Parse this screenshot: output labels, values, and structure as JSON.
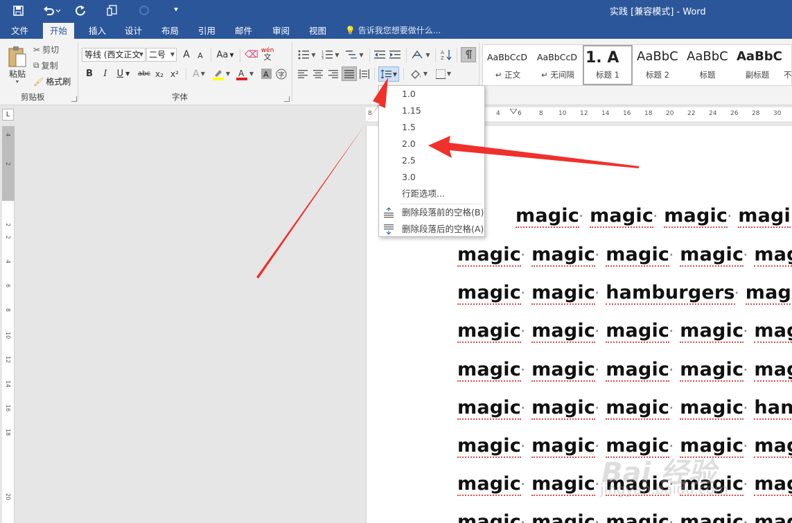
{
  "window": {
    "title": "实践 [兼容模式] - Word"
  },
  "quick_access": {
    "icons": [
      "save-icon",
      "undo-icon",
      "redo-icon",
      "touch-mode-icon",
      "customize-icon"
    ]
  },
  "tabs": [
    {
      "label": "文件"
    },
    {
      "label": "开始"
    },
    {
      "label": "插入"
    },
    {
      "label": "设计"
    },
    {
      "label": "布局"
    },
    {
      "label": "引用"
    },
    {
      "label": "邮件"
    },
    {
      "label": "审阅"
    },
    {
      "label": "视图"
    }
  ],
  "tell_me": "告诉我您想要做什么...",
  "clipboard": {
    "paste": "粘贴",
    "cut": "剪切",
    "copy": "复制",
    "format_painter": "格式刷",
    "group": "剪贴板"
  },
  "font": {
    "name": "等线 (西文正文",
    "size": "二号",
    "grow_label": "A",
    "shrink_label": "A",
    "case_label": "Aa",
    "phonetic_label": "wén",
    "bold": "B",
    "italic": "I",
    "underline": "U",
    "strike": "abc",
    "subscript": "x₂",
    "superscript": "x²",
    "group": "字体",
    "highlight_color": "#ffff00",
    "font_color": "#e02020"
  },
  "styles": [
    {
      "sample": "AaBbCcD",
      "name": "↵ 正文"
    },
    {
      "sample": "AaBbCcD",
      "name": "↵ 无间隔"
    },
    {
      "sample": "1.  A",
      "name": "标题 1"
    },
    {
      "sample": "AaBbC",
      "name": "标题 2"
    },
    {
      "sample": "AaBbC",
      "name": "标题"
    },
    {
      "sample": "AaBbC",
      "name": "副标题"
    },
    {
      "sample": "",
      "name": "不"
    }
  ],
  "ruler": {
    "ticks": [
      "8",
      "4",
      "6",
      "8",
      "10",
      "12",
      "14",
      "16",
      "18",
      "20",
      "22",
      "24",
      "26",
      "28",
      "30"
    ],
    "vticks": [
      "4",
      "2",
      "2",
      "2",
      "4",
      "6",
      "8",
      "10",
      "12",
      "14",
      "16",
      "18",
      "20"
    ],
    "tab_selector": "L"
  },
  "line_spacing_menu": {
    "options": [
      "1.0",
      "1.15",
      "1.5",
      "2.0",
      "2.5",
      "3.0"
    ],
    "more": "行距选项...",
    "remove_before": "删除段落前的空格(B)",
    "remove_after": "删除段落后的空格(A)"
  },
  "document": {
    "lines": [
      [
        "magic",
        "magic",
        "magic",
        "magi"
      ],
      [
        "magic",
        "magic",
        "magic",
        "magic",
        "mag"
      ],
      [
        "magic",
        "magic",
        "hamburgers",
        "magi"
      ],
      [
        "magic",
        "magic",
        "magic",
        "magic",
        "mag"
      ],
      [
        "magic",
        "magic",
        "magic",
        "magic",
        "mag"
      ],
      [
        "magic",
        "magic",
        "magic",
        "magic",
        "han"
      ],
      [
        "magic",
        "magic",
        "magic",
        "magic",
        "mag"
      ],
      [
        "magic",
        "magic",
        "magic",
        "magic",
        "mag"
      ],
      [
        "magic",
        "magic",
        "magic",
        "magic",
        "mag"
      ]
    ]
  },
  "watermark": {
    "text": "Bai 经验",
    "sub": "jingyan.baidu.com"
  },
  "colors": {
    "accent": "#2b579a",
    "arrow": "#f0302a"
  }
}
